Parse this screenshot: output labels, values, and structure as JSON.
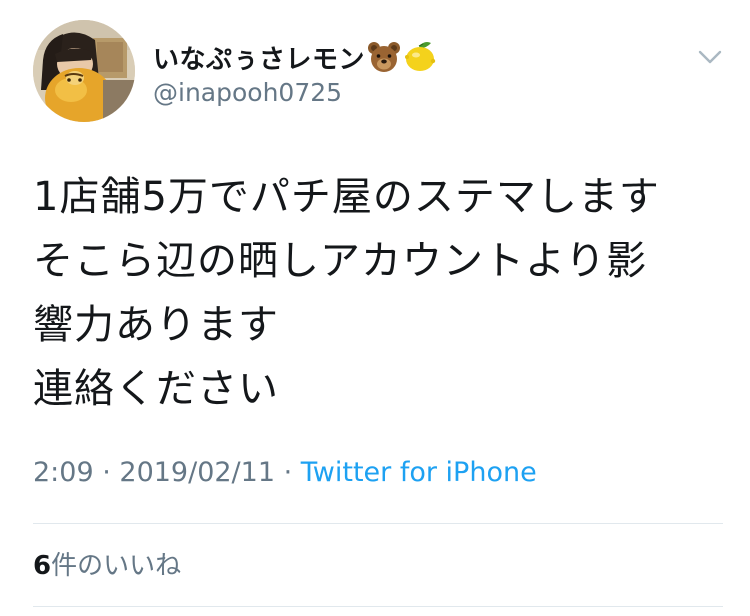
{
  "user": {
    "display_name": "いなぷぅさレモン",
    "emoji": [
      "bear-face-icon",
      "lemon-icon"
    ],
    "handle": "@inapooh0725"
  },
  "tweet": {
    "lines": [
      "1店舗5万でパチ屋のステマします",
      "そこら辺の晒しアカウントより影",
      "響力あります",
      "連絡ください"
    ],
    "time": "2:09",
    "separator": " · ",
    "date": "2019/02/11",
    "source": "Twitter for iPhone"
  },
  "likes": {
    "count": "6",
    "label": "件のいいね"
  },
  "colors": {
    "text": "#14171a",
    "secondary": "#657786",
    "link": "#1da1f2",
    "divider": "#e1e8ed"
  }
}
